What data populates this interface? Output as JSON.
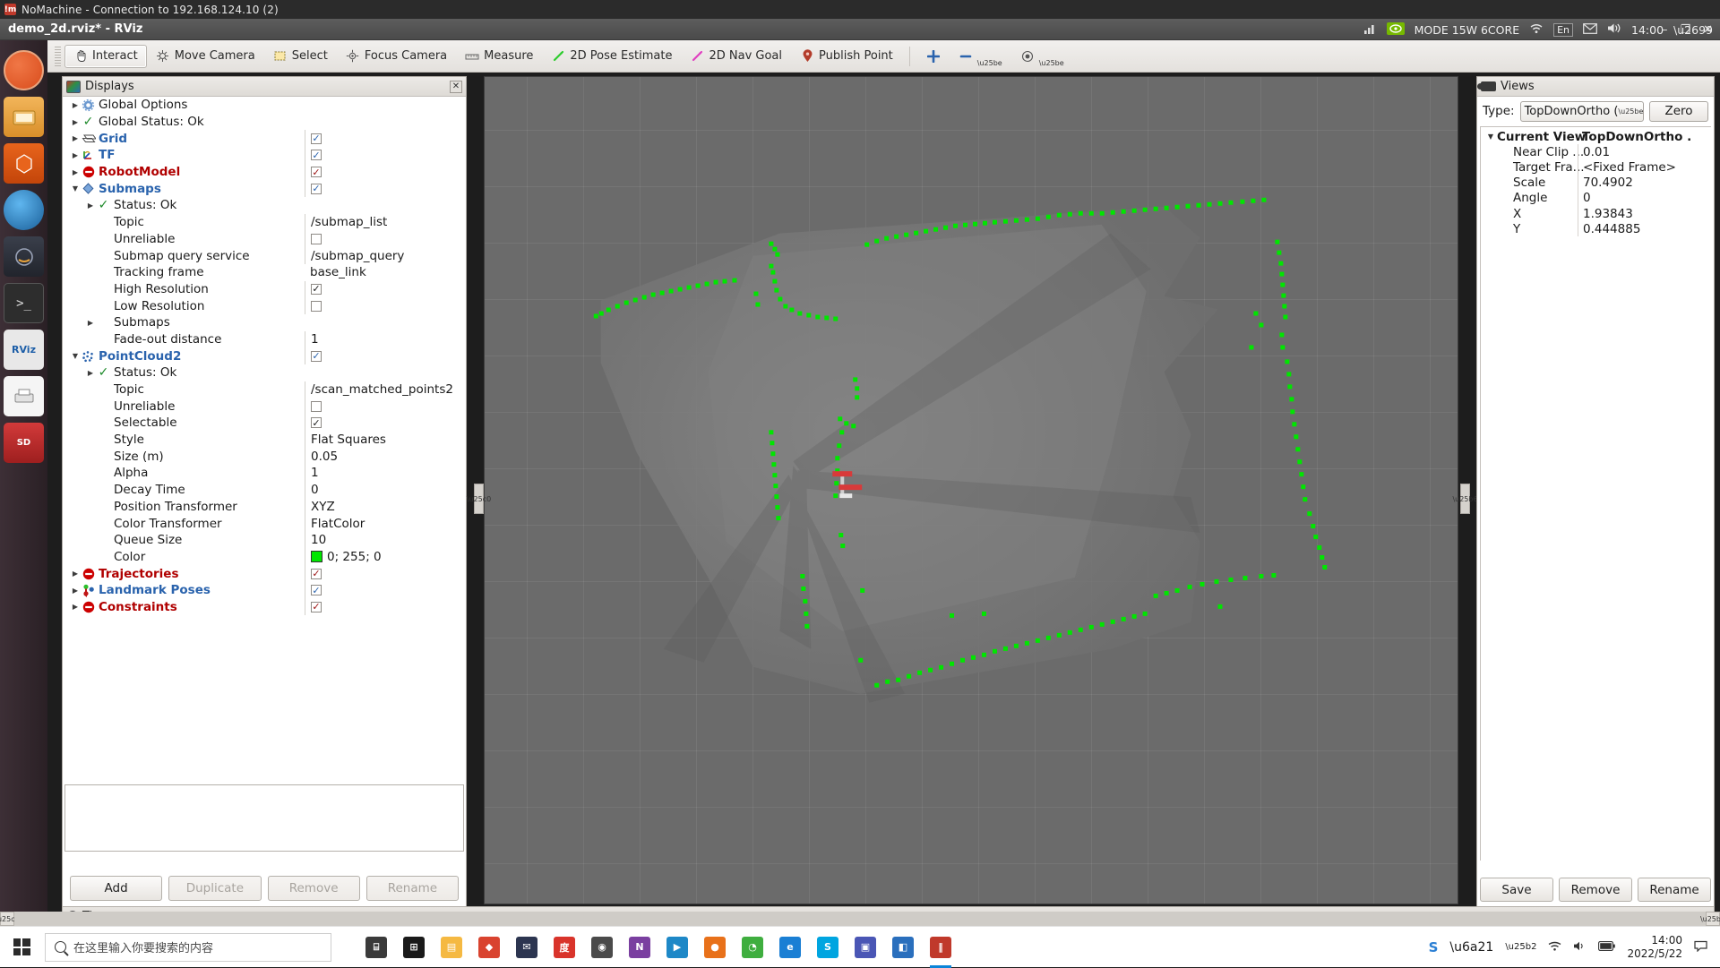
{
  "nomachine": {
    "title": "NoMachine - Connection to 192.168.124.10 (2)"
  },
  "rviz_window": {
    "title": "demo_2d.rviz* - RViz",
    "minimize": "–",
    "maximize": "❐",
    "close": "✕"
  },
  "toolbar": {
    "items": [
      {
        "label": "Interact",
        "icon": "hand-icon",
        "active": true
      },
      {
        "label": "Move Camera",
        "icon": "move-camera-icon",
        "active": false
      },
      {
        "label": "Select",
        "icon": "select-icon",
        "active": false
      },
      {
        "label": "Focus Camera",
        "icon": "focus-camera-icon",
        "active": false
      },
      {
        "label": "Measure",
        "icon": "measure-icon",
        "active": false
      },
      {
        "label": "2D Pose Estimate",
        "icon": "pose-estimate-icon",
        "active": false
      },
      {
        "label": "2D Nav Goal",
        "icon": "nav-goal-icon",
        "active": false
      },
      {
        "label": "Publish Point",
        "icon": "publish-point-icon",
        "active": false
      }
    ],
    "extra_icons": [
      "plus-icon",
      "minus-icon",
      "camera-icon"
    ]
  },
  "displays": {
    "panel_title": "Displays",
    "close_label": "✕",
    "tree": [
      {
        "indent": 0,
        "arrow": "right",
        "icon": "gear-icon",
        "label": "Global Options",
        "style": "plain",
        "value": "",
        "value_type": "none"
      },
      {
        "indent": 0,
        "arrow": "right",
        "icon": "check-icon",
        "label": "Global Status: Ok",
        "style": "plain",
        "value": "",
        "value_type": "none"
      },
      {
        "indent": 0,
        "arrow": "right",
        "icon": "grid-icon",
        "label": "Grid",
        "style": "bold-blue",
        "value": "✓",
        "value_type": "checkbox-blue"
      },
      {
        "indent": 0,
        "arrow": "right",
        "icon": "tf-axes-icon",
        "label": "TF",
        "style": "bold-blue",
        "value": "✓",
        "value_type": "checkbox-blue"
      },
      {
        "indent": 0,
        "arrow": "right",
        "icon": "error-icon",
        "label": "RobotModel",
        "style": "bold-red",
        "value": "✓",
        "value_type": "checkbox-red"
      },
      {
        "indent": 0,
        "arrow": "down",
        "icon": "diamond-icon",
        "label": "Submaps",
        "style": "bold-blue",
        "value": "✓",
        "value_type": "checkbox-blue"
      },
      {
        "indent": 1,
        "arrow": "right",
        "icon": "check-icon",
        "label": "Status: Ok",
        "style": "plain",
        "value": "",
        "value_type": "none"
      },
      {
        "indent": 1,
        "arrow": "none",
        "icon": "",
        "label": "Topic",
        "style": "plain",
        "value": "/submap_list",
        "value_type": "text"
      },
      {
        "indent": 1,
        "arrow": "none",
        "icon": "",
        "label": "Unreliable",
        "style": "plain",
        "value": "",
        "value_type": "checkbox-empty"
      },
      {
        "indent": 1,
        "arrow": "none",
        "icon": "",
        "label": "Submap query service",
        "style": "plain",
        "value": "/submap_query",
        "value_type": "text"
      },
      {
        "indent": 1,
        "arrow": "none",
        "icon": "",
        "label": "Tracking frame",
        "style": "plain",
        "value": "base_link",
        "value_type": "text-novline"
      },
      {
        "indent": 1,
        "arrow": "none",
        "icon": "",
        "label": "High Resolution",
        "style": "plain",
        "value": "✓",
        "value_type": "checkbox-dark"
      },
      {
        "indent": 1,
        "arrow": "none",
        "icon": "",
        "label": "Low Resolution",
        "style": "plain",
        "value": "",
        "value_type": "checkbox-empty"
      },
      {
        "indent": 1,
        "arrow": "right",
        "icon": "",
        "label": "Submaps",
        "style": "plain",
        "value": "",
        "value_type": "none"
      },
      {
        "indent": 1,
        "arrow": "none",
        "icon": "",
        "label": "Fade-out distance",
        "style": "plain",
        "value": "1",
        "value_type": "text"
      },
      {
        "indent": 0,
        "arrow": "down",
        "icon": "pointcloud-icon",
        "label": "PointCloud2",
        "style": "bold-blue",
        "value": "✓",
        "value_type": "checkbox-blue"
      },
      {
        "indent": 1,
        "arrow": "right",
        "icon": "check-icon",
        "label": "Status: Ok",
        "style": "plain",
        "value": "",
        "value_type": "none"
      },
      {
        "indent": 1,
        "arrow": "none",
        "icon": "",
        "label": "Topic",
        "style": "plain",
        "value": "/scan_matched_points2",
        "value_type": "text"
      },
      {
        "indent": 1,
        "arrow": "none",
        "icon": "",
        "label": "Unreliable",
        "style": "plain",
        "value": "",
        "value_type": "checkbox-empty"
      },
      {
        "indent": 1,
        "arrow": "none",
        "icon": "",
        "label": "Selectable",
        "style": "plain",
        "value": "✓",
        "value_type": "checkbox-dark"
      },
      {
        "indent": 1,
        "arrow": "none",
        "icon": "",
        "label": "Style",
        "style": "plain",
        "value": "Flat Squares",
        "value_type": "text"
      },
      {
        "indent": 1,
        "arrow": "none",
        "icon": "",
        "label": "Size (m)",
        "style": "plain",
        "value": "0.05",
        "value_type": "text"
      },
      {
        "indent": 1,
        "arrow": "none",
        "icon": "",
        "label": "Alpha",
        "style": "plain",
        "value": "1",
        "value_type": "text"
      },
      {
        "indent": 1,
        "arrow": "none",
        "icon": "",
        "label": "Decay Time",
        "style": "plain",
        "value": "0",
        "value_type": "text"
      },
      {
        "indent": 1,
        "arrow": "none",
        "icon": "",
        "label": "Position Transformer",
        "style": "plain",
        "value": "XYZ",
        "value_type": "text"
      },
      {
        "indent": 1,
        "arrow": "none",
        "icon": "",
        "label": "Color Transformer",
        "style": "plain",
        "value": "FlatColor",
        "value_type": "text"
      },
      {
        "indent": 1,
        "arrow": "none",
        "icon": "",
        "label": "Queue Size",
        "style": "plain",
        "value": "10",
        "value_type": "text"
      },
      {
        "indent": 1,
        "arrow": "none",
        "icon": "",
        "label": "Color",
        "style": "plain",
        "value": "0; 255; 0",
        "value_type": "color",
        "color_hex": "#00e600"
      },
      {
        "indent": 0,
        "arrow": "right",
        "icon": "error-icon",
        "label": "Trajectories",
        "style": "bold-red",
        "value": "✓",
        "value_type": "checkbox-red"
      },
      {
        "indent": 0,
        "arrow": "right",
        "icon": "landmark-icon",
        "label": "Landmark Poses",
        "style": "bold-blue",
        "value": "✓",
        "value_type": "checkbox-blue"
      },
      {
        "indent": 0,
        "arrow": "right",
        "icon": "error-icon",
        "label": "Constraints",
        "style": "bold-red",
        "value": "✓",
        "value_type": "checkbox-red"
      }
    ],
    "buttons": [
      {
        "label": "Add",
        "enabled": true
      },
      {
        "label": "Duplicate",
        "enabled": false
      },
      {
        "label": "Remove",
        "enabled": false
      },
      {
        "label": "Rename",
        "enabled": false
      }
    ]
  },
  "views": {
    "panel_title": "Views",
    "type_label": "Type:",
    "type_value": "TopDownOrtho (",
    "zero_label": "Zero",
    "tree": [
      {
        "arrow": "down",
        "label": "Current View",
        "value": "TopDownOrtho .",
        "head": true,
        "indent": 0
      },
      {
        "arrow": "",
        "label": "Near Clip ...",
        "value": "0.01",
        "head": false,
        "indent": 1
      },
      {
        "arrow": "",
        "label": "Target Fra...",
        "value": "<Fixed Frame>",
        "head": false,
        "indent": 1
      },
      {
        "arrow": "",
        "label": "Scale",
        "value": "70.4902",
        "head": false,
        "indent": 1
      },
      {
        "arrow": "",
        "label": "Angle",
        "value": "0",
        "head": false,
        "indent": 1
      },
      {
        "arrow": "",
        "label": "X",
        "value": "1.93843",
        "head": false,
        "indent": 1
      },
      {
        "arrow": "",
        "label": "Y",
        "value": "0.444885",
        "head": false,
        "indent": 1
      }
    ],
    "buttons": [
      {
        "label": "Save"
      },
      {
        "label": "Remove"
      },
      {
        "label": "Rename"
      }
    ]
  },
  "time_panel": {
    "label": "Time"
  },
  "viewport": {
    "point_color": "#00e600",
    "background": "#6b6b6b",
    "robot_marker_color": "#d83a3a"
  },
  "system_tray": {
    "mode_label": "MODE 15W 6CORE",
    "keyboard": "En",
    "clock": "14:00",
    "icons": [
      "signal-icon",
      "nvidia-icon",
      "wifi-icon",
      "mail-icon",
      "volume-icon",
      "gear-icon"
    ]
  },
  "taskbar": {
    "search_placeholder": "在这里输入你要搜索的内容",
    "clock_time": "14:00",
    "clock_date": "2022/5/22",
    "apps": [
      {
        "name": "task-view-icon",
        "color": "#3a3a3a",
        "glyph": "⌸"
      },
      {
        "name": "microsoft-store-icon",
        "color": "#1a1a1a",
        "glyph": "⊞"
      },
      {
        "name": "file-explorer-icon",
        "color": "#f5b942",
        "glyph": "▤"
      },
      {
        "name": "app-red-diamond-icon",
        "color": "#d9432f",
        "glyph": "◆"
      },
      {
        "name": "mail-app-icon",
        "color": "#2c3550",
        "glyph": "✉"
      },
      {
        "name": "baidu-app-icon",
        "color": "#d9342b",
        "glyph": "度"
      },
      {
        "name": "camera-app-icon",
        "color": "#4a4a4a",
        "glyph": "◉"
      },
      {
        "name": "onenote-app-icon",
        "color": "#7a3fa0",
        "glyph": "N"
      },
      {
        "name": "video-app-icon",
        "color": "#1e88c7",
        "glyph": "▶"
      },
      {
        "name": "firefox-app-icon",
        "color": "#e8711a",
        "glyph": "●"
      },
      {
        "name": "wechat-app-icon",
        "color": "#3fae3f",
        "glyph": "◔"
      },
      {
        "name": "edge-app-icon",
        "color": "#1a7fd4",
        "glyph": "e"
      },
      {
        "name": "skype-app-icon",
        "color": "#00a5e0",
        "glyph": "S"
      },
      {
        "name": "teams-app-icon",
        "color": "#4a56b5",
        "glyph": "▣"
      },
      {
        "name": "vscode-app-icon",
        "color": "#2a6fbd",
        "glyph": "◧"
      },
      {
        "name": "nomachine-app-icon",
        "color": "#c0392b",
        "glyph": "‖"
      }
    ],
    "right_icons": [
      "sogou-icon",
      "input-method-icon",
      "chevron-up-icon",
      "network-icon",
      "volume-icon",
      "battery-icon",
      "notification-icon"
    ]
  }
}
